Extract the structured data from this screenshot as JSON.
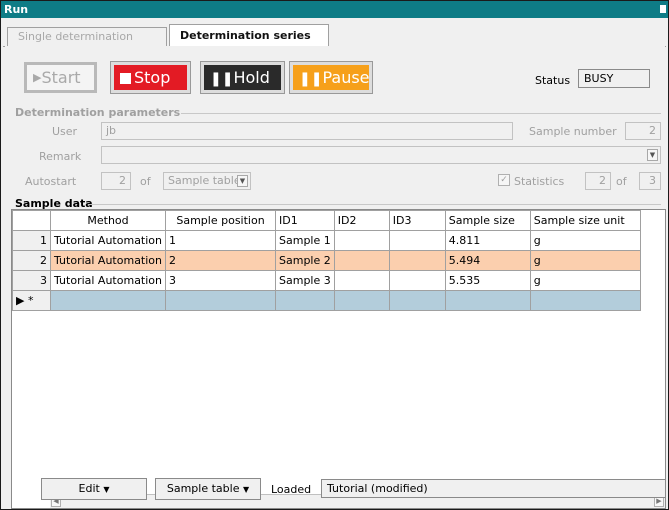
{
  "window": {
    "title": "Run"
  },
  "tabs": [
    {
      "label": "Single determination",
      "active": false
    },
    {
      "label": "Determination series",
      "active": true
    }
  ],
  "controls": {
    "start_label": "Start",
    "stop_label": "Stop",
    "hold_label": "Hold",
    "pause_label": "Pause",
    "status_label": "Status",
    "status_value": "BUSY"
  },
  "params": {
    "title": "Determination parameters",
    "user_label": "User",
    "user_value": "jb",
    "sample_number_label": "Sample number",
    "sample_number_value": "2",
    "remark_label": "Remark",
    "remark_value": "",
    "autostart_label": "Autostart",
    "autostart_value": "2",
    "of_label": "of",
    "autostart_source": "Sample table",
    "statistics_label": "Statistics",
    "statistics_checked": true,
    "statistics_value": "2",
    "statistics_of_label": "of",
    "statistics_total": "3"
  },
  "sample_data": {
    "title": "Sample data",
    "columns": [
      "Method",
      "Sample position",
      "ID1",
      "ID2",
      "ID3",
      "Sample size",
      "Sample size unit"
    ],
    "rows": [
      {
        "num": "1",
        "cells": [
          "Tutorial Automation",
          "1",
          "Sample 1",
          "",
          "",
          "4.811",
          "g"
        ]
      },
      {
        "num": "2",
        "cells": [
          "Tutorial Automation",
          "2",
          "Sample 2",
          "",
          "",
          "5.494",
          "g"
        ]
      },
      {
        "num": "3",
        "cells": [
          "Tutorial Automation",
          "3",
          "Sample 3",
          "",
          "",
          "5.535",
          "g"
        ]
      }
    ],
    "new_row_marker": "▶ *"
  },
  "footer": {
    "edit_label": "Edit",
    "sample_table_label": "Sample table",
    "loaded_label": "Loaded",
    "loaded_value": "Tutorial (modified)"
  },
  "colors": {
    "titlebar": "#0e7c86",
    "stop": "#e31b24",
    "hold": "#2a2a2a",
    "pause": "#f6a01a",
    "selected_row": "#fbcfae",
    "new_row": "#b3cddb"
  }
}
